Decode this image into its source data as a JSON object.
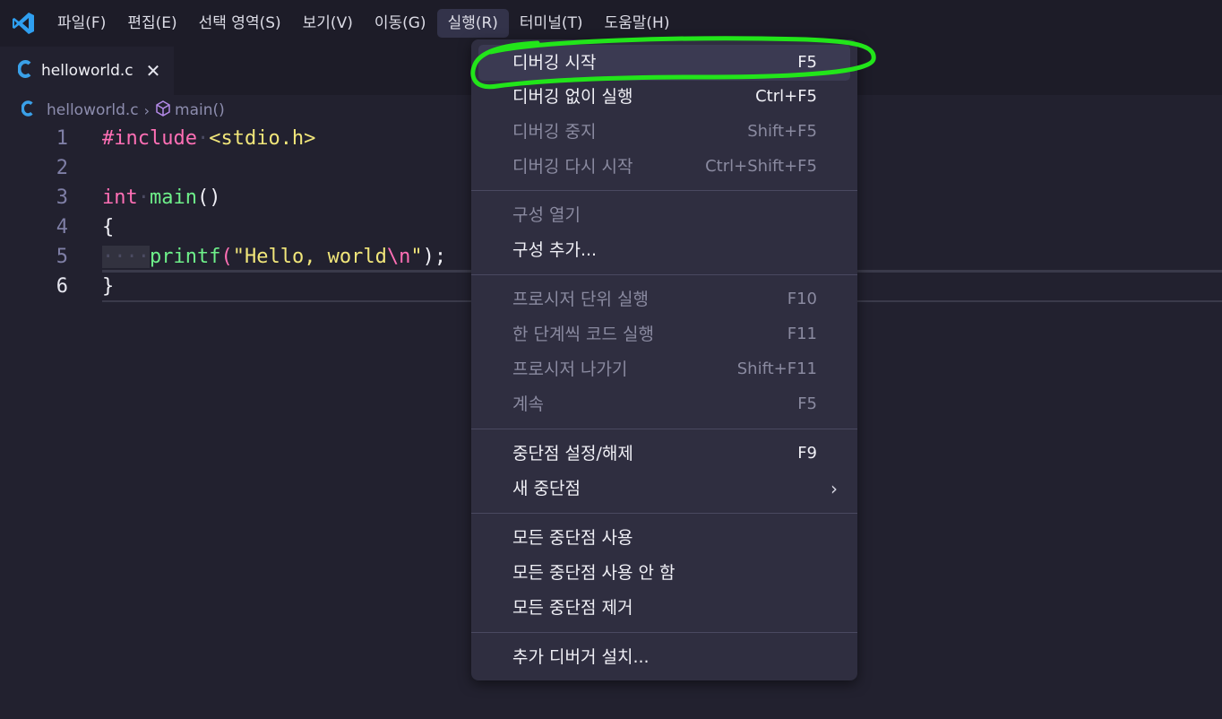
{
  "menubar": {
    "app_icon": "vscode-logo-icon",
    "items": [
      {
        "label": "파일(F)"
      },
      {
        "label": "편집(E)"
      },
      {
        "label": "선택 영역(S)"
      },
      {
        "label": "보기(V)"
      },
      {
        "label": "이동(G)"
      },
      {
        "label": "실행(R)",
        "active": true
      },
      {
        "label": "터미널(T)"
      },
      {
        "label": "도움말(H)"
      }
    ]
  },
  "tab": {
    "icon": "c-file-icon",
    "label": "helloworld.c",
    "close": "✕"
  },
  "breadcrumb": {
    "file": "helloworld.c",
    "separator": "›",
    "symbol": "main()"
  },
  "editor": {
    "lines": [
      {
        "number": "1"
      },
      {
        "number": "2"
      },
      {
        "number": "3"
      },
      {
        "number": "4"
      },
      {
        "number": "5"
      },
      {
        "number": "6"
      }
    ],
    "tokens": {
      "include_kw": "#include",
      "include_file": "<stdio.h>",
      "int_kw": "int",
      "main_fn": "main",
      "parens": "()",
      "open_brace": "{",
      "printf_fn": "printf",
      "open_paren": "(",
      "str_start": "\"Hello, world",
      "escape": "\\n",
      "str_end": "\"",
      "close_stmt": ");",
      "close_brace": "}"
    }
  },
  "run_menu": {
    "items": [
      {
        "label": "디버깅 시작",
        "shortcut": "F5",
        "enabled": true,
        "highlighted": true
      },
      {
        "label": "디버깅 없이 실행",
        "shortcut": "Ctrl+F5",
        "enabled": true
      },
      {
        "label": "디버깅 중지",
        "shortcut": "Shift+F5",
        "enabled": false
      },
      {
        "label": "디버깅 다시 시작",
        "shortcut": "Ctrl+Shift+F5",
        "enabled": false
      },
      {
        "label": "구성 열기",
        "shortcut": "",
        "enabled": false
      },
      {
        "label": "구성 추가...",
        "shortcut": "",
        "enabled": true
      },
      {
        "label": "프로시저 단위 실행",
        "shortcut": "F10",
        "enabled": false
      },
      {
        "label": "한 단계씩 코드 실행",
        "shortcut": "F11",
        "enabled": false
      },
      {
        "label": "프로시저 나가기",
        "shortcut": "Shift+F11",
        "enabled": false
      },
      {
        "label": "계속",
        "shortcut": "F5",
        "enabled": false
      },
      {
        "label": "중단점 설정/해제",
        "shortcut": "F9",
        "enabled": true
      },
      {
        "label": "새 중단점",
        "shortcut": "",
        "enabled": true,
        "submenu": true
      },
      {
        "label": "모든 중단점 사용",
        "shortcut": "",
        "enabled": true
      },
      {
        "label": "모든 중단점 사용 안 함",
        "shortcut": "",
        "enabled": true
      },
      {
        "label": "모든 중단점 제거",
        "shortcut": "",
        "enabled": true
      },
      {
        "label": "추가 디버거 설치...",
        "shortcut": "",
        "enabled": true
      }
    ],
    "submenu_arrow": "›"
  },
  "colors": {
    "background": "#22212f",
    "menubar": "#1d1c28",
    "menu_panel": "#2f2e40",
    "annotation_green": "#22e51a"
  }
}
